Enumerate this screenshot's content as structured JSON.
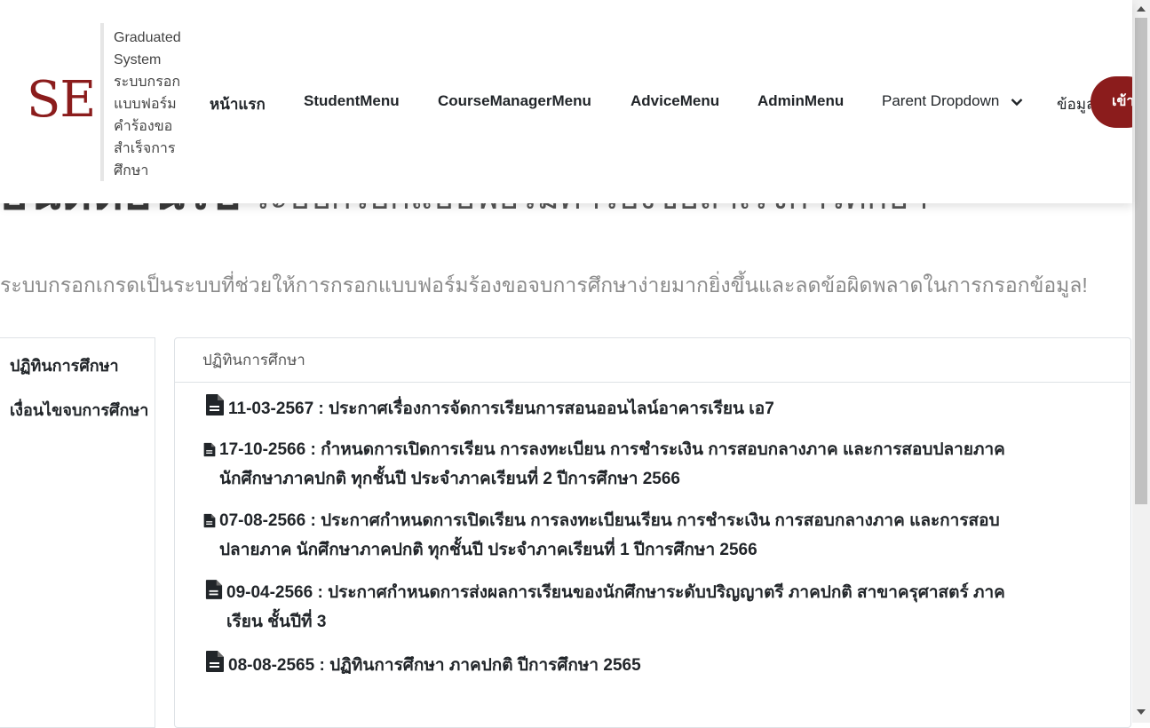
{
  "hero": {
    "title_main": "ยินดีต้อนรับ",
    "title_sub": "ระบบกรอกแบบฟอร์มคำร้องขอสำเร็จการศึกษา",
    "subtitle": "ระบบกรอกเกรดเป็นระบบที่ช่วยให้การกรอกแบบฟอร์มร้องขอจบการศึกษาง่ายมากยิ่งขึ้นและลดข้อผิดพลาดในการกรอกข้อมูล!"
  },
  "brand": {
    "logo": "SE",
    "lines": [
      "Graduated",
      "System",
      "ระบบกรอก",
      "แบบฟอร์ม",
      "คำร้องขอ",
      "สำเร็จการ",
      "ศึกษา"
    ],
    "color": "#8b1c1c"
  },
  "nav": {
    "home": "หน้าแรก",
    "student": "StudentMenu",
    "course_manager": "CourseManagerMenu",
    "advice": "AdviceMenu",
    "admin": "AdminMenu",
    "parent_dropdown": "Parent Dropdown",
    "info": "ข้อมูล",
    "login": "เข้าสู่ระบบ"
  },
  "sidebar": {
    "items": [
      "ปฏิทินการศึกษา",
      "เงื่อนไขจบการศึกษา"
    ]
  },
  "card": {
    "header": "ปฏิทินการศึกษา",
    "announcements": [
      {
        "text": "11-03-2567 : ประกาศเรื่องการจัดการเรียนการสอนออนไลน์อาคารเรียน เอ7",
        "line2": "",
        "icon": "document-icon"
      },
      {
        "text": "17-10-2566 : กำหนดการเปิดการเรียน การลงทะเบียน การชำระเงิน การสอบกลางภาค และการสอบปลายภาค",
        "line2": "นักศึกษาภาคปกติ ทุกชั้นปี ประจำภาคเรียนที่ 2 ปีการศึกษา 2566",
        "icon": "document-icon"
      },
      {
        "text": "07-08-2566 : ประกาศกำหนดการเปิดเรียน การลงทะเบียนเรียน การชำระเงิน การสอบกลางภาค และการสอบ",
        "line2": "ปลายภาค นักศึกษาภาคปกติ ทุกชั้นปี ประจำภาคเรียนที่ 1 ปีการศึกษา 2566",
        "icon": "document-icon"
      },
      {
        "text": "09-04-2566 : ประกาศกำหนดการส่งผลการเรียนของนักศึกษาระดับปริญญาตรี ภาคปกติ สาขาครุศาสตร์ ภาค",
        "line2": "เรียน ชั้นปีที่ 3",
        "icon": "document-icon"
      },
      {
        "text": "08-08-2565 : ปฏิทินการศึกษา ภาคปกติ ปีการศึกษา 2565",
        "line2": "",
        "icon": "document-icon"
      }
    ]
  }
}
